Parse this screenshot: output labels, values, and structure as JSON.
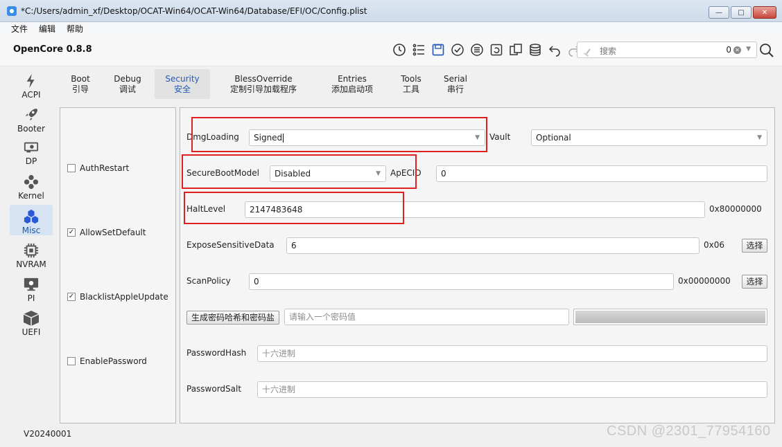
{
  "window": {
    "title": "*C:/Users/admin_xf/Desktop/OCAT-Win64/OCAT-Win64/Database/EFI/OC/Config.plist"
  },
  "menu": [
    "文件",
    "编辑",
    "帮助"
  ],
  "toolbar": {
    "brand": "OpenCore 0.8.8",
    "search": {
      "placeholder": "搜索",
      "count": "0"
    }
  },
  "sidebar": {
    "items": [
      {
        "label": "ACPI",
        "icon": "lightning-icon"
      },
      {
        "label": "Booter",
        "icon": "rocket-icon"
      },
      {
        "label": "DP",
        "icon": "graphics-card-icon"
      },
      {
        "label": "Kernel",
        "icon": "kernel-icon"
      },
      {
        "label": "Misc",
        "icon": "misc-icon",
        "active": true
      },
      {
        "label": "NVRAM",
        "icon": "chip-icon"
      },
      {
        "label": "PI",
        "icon": "apple-monitor-icon"
      },
      {
        "label": "UEFI",
        "icon": "cube-icon"
      }
    ]
  },
  "tabs": [
    {
      "en": "Boot",
      "zh": "引导"
    },
    {
      "en": "Debug",
      "zh": "调试"
    },
    {
      "en": "Security",
      "zh": "安全",
      "active": true
    },
    {
      "en": "BlessOverride",
      "zh": "定制引导加载程序"
    },
    {
      "en": "Entries",
      "zh": "添加启动项"
    },
    {
      "en": "Tools",
      "zh": "工具"
    },
    {
      "en": "Serial",
      "zh": "串行"
    }
  ],
  "security": {
    "checkboxes": [
      {
        "label": "AuthRestart",
        "checked": false
      },
      {
        "label": "AllowSetDefault",
        "checked": true
      },
      {
        "label": "BlacklistAppleUpdate",
        "checked": true
      },
      {
        "label": "EnablePassword",
        "checked": false
      }
    ],
    "dmg_loading": {
      "label": "DmgLoading",
      "value": "Signed"
    },
    "vault": {
      "label": "Vault",
      "value": "Optional"
    },
    "secure_boot_model": {
      "label": "SecureBootModel",
      "value": "Disabled"
    },
    "apecid": {
      "label": "ApECID",
      "value": "0"
    },
    "halt_level": {
      "label": "HaltLevel",
      "value": "2147483648",
      "hex": "0x80000000"
    },
    "expose_sensitive_data": {
      "label": "ExposeSensitiveData",
      "value": "6",
      "hex": "0x06",
      "button": "选择"
    },
    "scan_policy": {
      "label": "ScanPolicy",
      "value": "0",
      "hex": "0x00000000",
      "button": "选择"
    },
    "password_gen": {
      "button": "生成密码哈希和密码盐",
      "placeholder": "请输入一个密码值"
    },
    "password_hash": {
      "label": "PasswordHash",
      "placeholder": "十六进制"
    },
    "password_salt": {
      "label": "PasswordSalt",
      "placeholder": "十六进制"
    }
  },
  "status": {
    "version": "V20240001"
  },
  "watermark": "CSDN @2301_77954160"
}
